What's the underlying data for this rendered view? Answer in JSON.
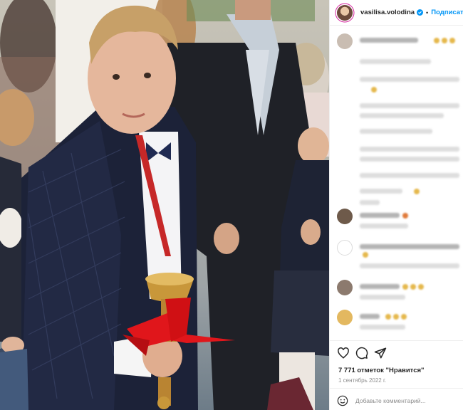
{
  "post": {
    "username": "vasilisa.volodina",
    "follow_label": "Подписаться",
    "dot": "•",
    "likes_text": "7 771 отметок \"Нравится\"",
    "date_text": "1 сентябрь 2022 г.",
    "comment_placeholder": "Добавьте комментарий..."
  },
  "icons": {
    "verified": "verified-badge-icon",
    "like": "heart-icon",
    "comment": "comment-bubble-icon",
    "share": "paper-plane-icon",
    "emoji": "smiley-icon"
  },
  "colors": {
    "accent": "#0095f6",
    "text": "#262626",
    "muted": "#8e8e8e",
    "ribbon": "#e0161b",
    "jacket": "#1c2238",
    "bell": "#c8973a"
  }
}
